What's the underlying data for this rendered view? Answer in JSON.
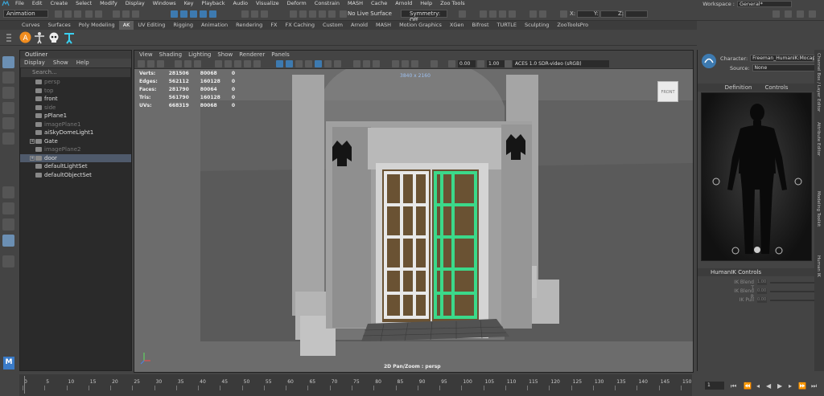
{
  "menubar": {
    "items": [
      "File",
      "Edit",
      "Create",
      "Select",
      "Modify",
      "Display",
      "Windows",
      "Key",
      "Playback",
      "Audio",
      "Visualize",
      "Deform",
      "Constrain",
      "MASH",
      "Cache",
      "Arnold",
      "Help",
      "Zoo Tools"
    ],
    "workspace_label": "Workspace :",
    "workspace_value": "General*"
  },
  "statusline": {
    "mode": "Animation",
    "live_surface": "No Live Surface",
    "symmetry": "Symmetry: Off",
    "x_label": "X:",
    "y_label": "Y:",
    "z_label": "Z:"
  },
  "shelf": {
    "tabs": [
      "Curves",
      "Surfaces",
      "Poly Modeling",
      "AK",
      "UV Editing",
      "Rigging",
      "Animation",
      "Rendering",
      "FX",
      "FX Caching",
      "Custom",
      "Arnold",
      "MASH",
      "Motion Graphics",
      "XGen",
      "Bifrost",
      "TURTLE",
      "Sculpting",
      "ZooToolsPro"
    ],
    "active": "AK"
  },
  "outliner": {
    "title": "Outliner",
    "menu": [
      "Display",
      "Show",
      "Help"
    ],
    "search_placeholder": "Search...",
    "items": [
      {
        "label": "persp",
        "dim": true,
        "sel": false,
        "expand": false
      },
      {
        "label": "top",
        "dim": true,
        "sel": false,
        "expand": false
      },
      {
        "label": "front",
        "dim": false,
        "sel": false,
        "expand": false
      },
      {
        "label": "side",
        "dim": true,
        "sel": false,
        "expand": false
      },
      {
        "label": "pPlane1",
        "dim": false,
        "sel": false,
        "expand": false
      },
      {
        "label": "imagePlane1",
        "dim": true,
        "sel": false,
        "expand": false
      },
      {
        "label": "aiSkyDomeLight1",
        "dim": false,
        "sel": false,
        "expand": false
      },
      {
        "label": "Gate",
        "dim": false,
        "sel": false,
        "expand": true
      },
      {
        "label": "imagePlane2",
        "dim": true,
        "sel": false,
        "expand": false
      },
      {
        "label": "door",
        "dim": false,
        "sel": true,
        "expand": true
      },
      {
        "label": "defaultLightSet",
        "dim": false,
        "sel": false,
        "expand": false
      },
      {
        "label": "defaultObjectSet",
        "dim": false,
        "sel": false,
        "expand": false
      }
    ]
  },
  "viewport": {
    "menu": [
      "View",
      "Shading",
      "Lighting",
      "Show",
      "Renderer",
      "Panels"
    ],
    "exposure": "0.00",
    "gamma": "1.00",
    "colorspace": "ACES 1.0 SDR-video (sRGB)",
    "hud": [
      {
        "label": "Verts:",
        "a": "281506",
        "b": "80068",
        "c": "0"
      },
      {
        "label": "Edges:",
        "a": "562112",
        "b": "160128",
        "c": "0"
      },
      {
        "label": "Faces:",
        "a": "281790",
        "b": "80064",
        "c": "0"
      },
      {
        "label": "Tris:",
        "a": "561790",
        "b": "160128",
        "c": "0"
      },
      {
        "label": "UVs:",
        "a": "668319",
        "b": "80068",
        "c": "0"
      }
    ],
    "resolution_gate": "3840 x 2160",
    "camera_label": "2D Pan/Zoom : persp",
    "viewcube_label": "FRONT"
  },
  "hik": {
    "character_label": "Character:",
    "character_value": "Freeman_HumanIK:Mocap",
    "source_label": "Source:",
    "source_value": "None",
    "tabs": [
      "Definition",
      "Controls"
    ],
    "controls_header": "HumanIK Controls",
    "blends": [
      {
        "label": "IK Blend T",
        "value": "1.00"
      },
      {
        "label": "IK Blend R",
        "value": "0.00"
      },
      {
        "label": "IK Pull",
        "value": "0.00"
      }
    ],
    "side_tabs": [
      "Channel Box / Layer Editor",
      "Attribute Editor",
      "Modeling Toolkit",
      "Human IK"
    ]
  },
  "timeline": {
    "ticks": [
      "0",
      "5",
      "10",
      "15",
      "20",
      "25",
      "30",
      "35",
      "40",
      "45",
      "50",
      "55",
      "60",
      "65",
      "70",
      "75",
      "80",
      "85",
      "90",
      "95",
      "100",
      "105",
      "110",
      "115",
      "120",
      "125",
      "130",
      "135",
      "140",
      "145",
      "150"
    ],
    "current_frame": "1"
  },
  "colors": {
    "accent": "#3d7ab0",
    "selection": "#4f5a6b",
    "door_wood": "#6a5233",
    "door_highlight": "#3bd98a"
  }
}
